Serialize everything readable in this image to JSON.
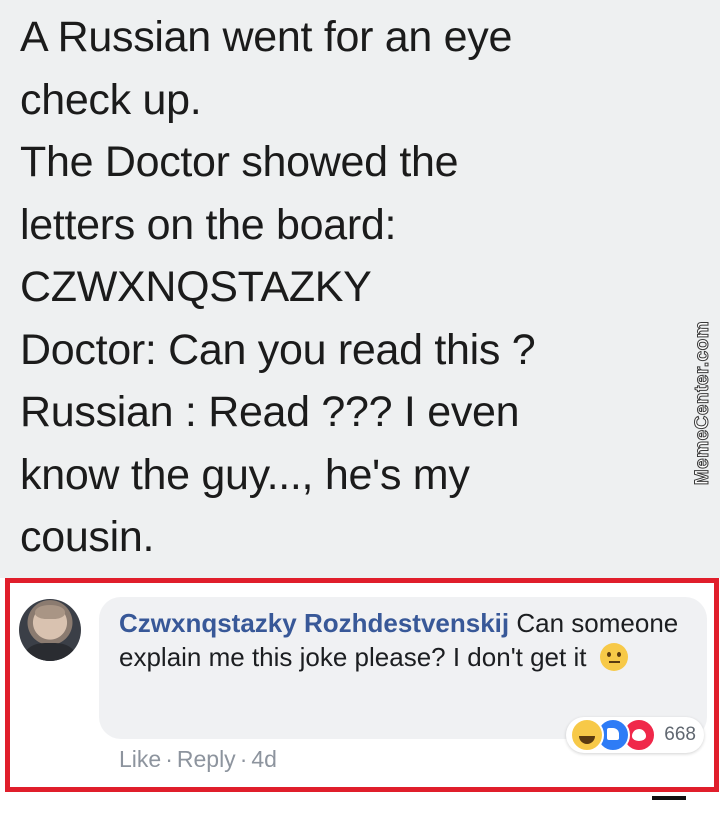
{
  "post": {
    "lines": [
      "A Russian went for an eye",
      "check up.",
      "The Doctor showed the",
      "letters on the board:",
      "CZWXNQSTAZKY",
      "Doctor: Can you read this ?",
      "Russian : Read ??? I even",
      "know the guy..., he's my",
      "cousin."
    ],
    "background": "#eef0f1"
  },
  "watermark": {
    "text": "MemeCenter.com"
  },
  "comment": {
    "author": "Czwxnqstazky Rozhdestvenskij",
    "text": "Can someone explain me this joke please? I don't get it",
    "emoji": "neutral-face-icon",
    "actions": {
      "like": "Like",
      "reply": "Reply",
      "time": "4d"
    },
    "reactions": {
      "icons": [
        "haha-icon",
        "like-icon",
        "love-icon"
      ],
      "count": "668"
    },
    "highlight_color": "#e01e2b",
    "author_color": "#385898"
  }
}
